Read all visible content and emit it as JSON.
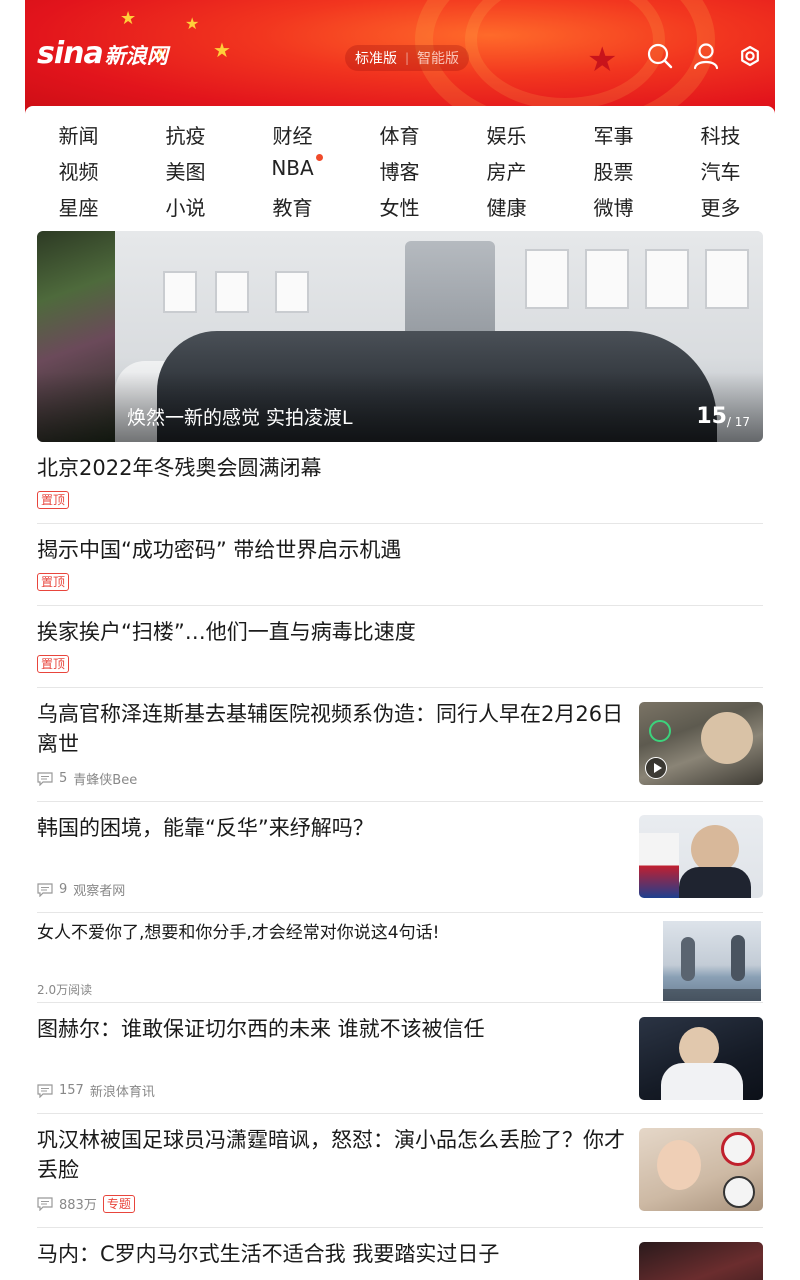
{
  "header": {
    "logo_latin": "sina",
    "logo_cn": "新浪网",
    "mode_active": "标准版",
    "mode_inactive": "智能版",
    "icons": [
      "search-icon",
      "user-icon",
      "settings-icon"
    ],
    "brand_color": "#e2141c"
  },
  "channels": [
    "新闻",
    "抗疫",
    "财经",
    "体育",
    "娱乐",
    "军事",
    "科技",
    "视频",
    "美图",
    "NBA",
    "博客",
    "房产",
    "股票",
    "汽车",
    "星座",
    "小说",
    "教育",
    "女性",
    "健康",
    "微博",
    "更多"
  ],
  "hero": {
    "caption": "焕然一新的感觉 实拍凌渡L",
    "index": "15",
    "total": "/ 17"
  },
  "pinned": [
    {
      "title": "北京2022年冬残奥会圆满闭幕",
      "tag": "置顶"
    },
    {
      "title": "揭示中国“成功密码” 带给世界启示机遇",
      "tag": "置顶"
    },
    {
      "title": "挨家挨户“扫楼”…他们一直与病毒比速度",
      "tag": "置顶"
    }
  ],
  "articles": [
    {
      "title": "乌高官称泽连斯基去基辅医院视频系伪造：同行人早在2月26日离世",
      "comments": "5",
      "source": "青蜂侠Bee",
      "has_video": true
    },
    {
      "title": "韩国的困境，能靠“反华”来纾解吗？",
      "comments": "9",
      "source": "观察者网"
    },
    {
      "title": "女人不爱你了,想要和你分手,才会经常对你说这4句话!",
      "reads": "2.0万阅读"
    },
    {
      "title": "图赫尔：谁敢保证切尔西的未来 谁就不该被信任",
      "comments": "157",
      "source": "新浪体育讯"
    },
    {
      "title": "巩汉林被国足球员冯潇霆暗讽，怒怼：演小品怎么丢脸了？你才丢脸",
      "comments": "883万",
      "tag": "专题"
    },
    {
      "title": "马内：C罗内马尔式生活不适合我 我要踏实过日子"
    }
  ]
}
